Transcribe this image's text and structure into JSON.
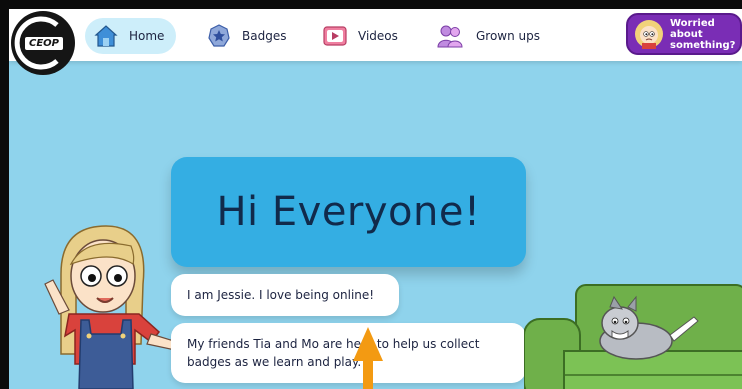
{
  "logo": {
    "text": "CEOP"
  },
  "nav": {
    "items": [
      {
        "label": "Home",
        "icon": "home-icon",
        "active": true
      },
      {
        "label": "Badges",
        "icon": "badge-icon",
        "active": false
      },
      {
        "label": "Videos",
        "icon": "video-play-icon",
        "active": false
      },
      {
        "label": "Grown ups",
        "icon": "grown-ups-icon",
        "active": false
      }
    ],
    "worried_button": {
      "label": "Worried about something?",
      "icon": "worried-avatar-icon"
    }
  },
  "hero": {
    "title": "Hi Everyone!"
  },
  "speech": {
    "line1": "I am Jessie. I love being online!",
    "line2": "My friends Tia and Mo are here to help us collect badges as we learn and play."
  },
  "colors": {
    "background": "#8fd3ec",
    "hero_panel": "#34aee3",
    "accent_purple": "#7a2db5",
    "arrow": "#f39a12"
  }
}
